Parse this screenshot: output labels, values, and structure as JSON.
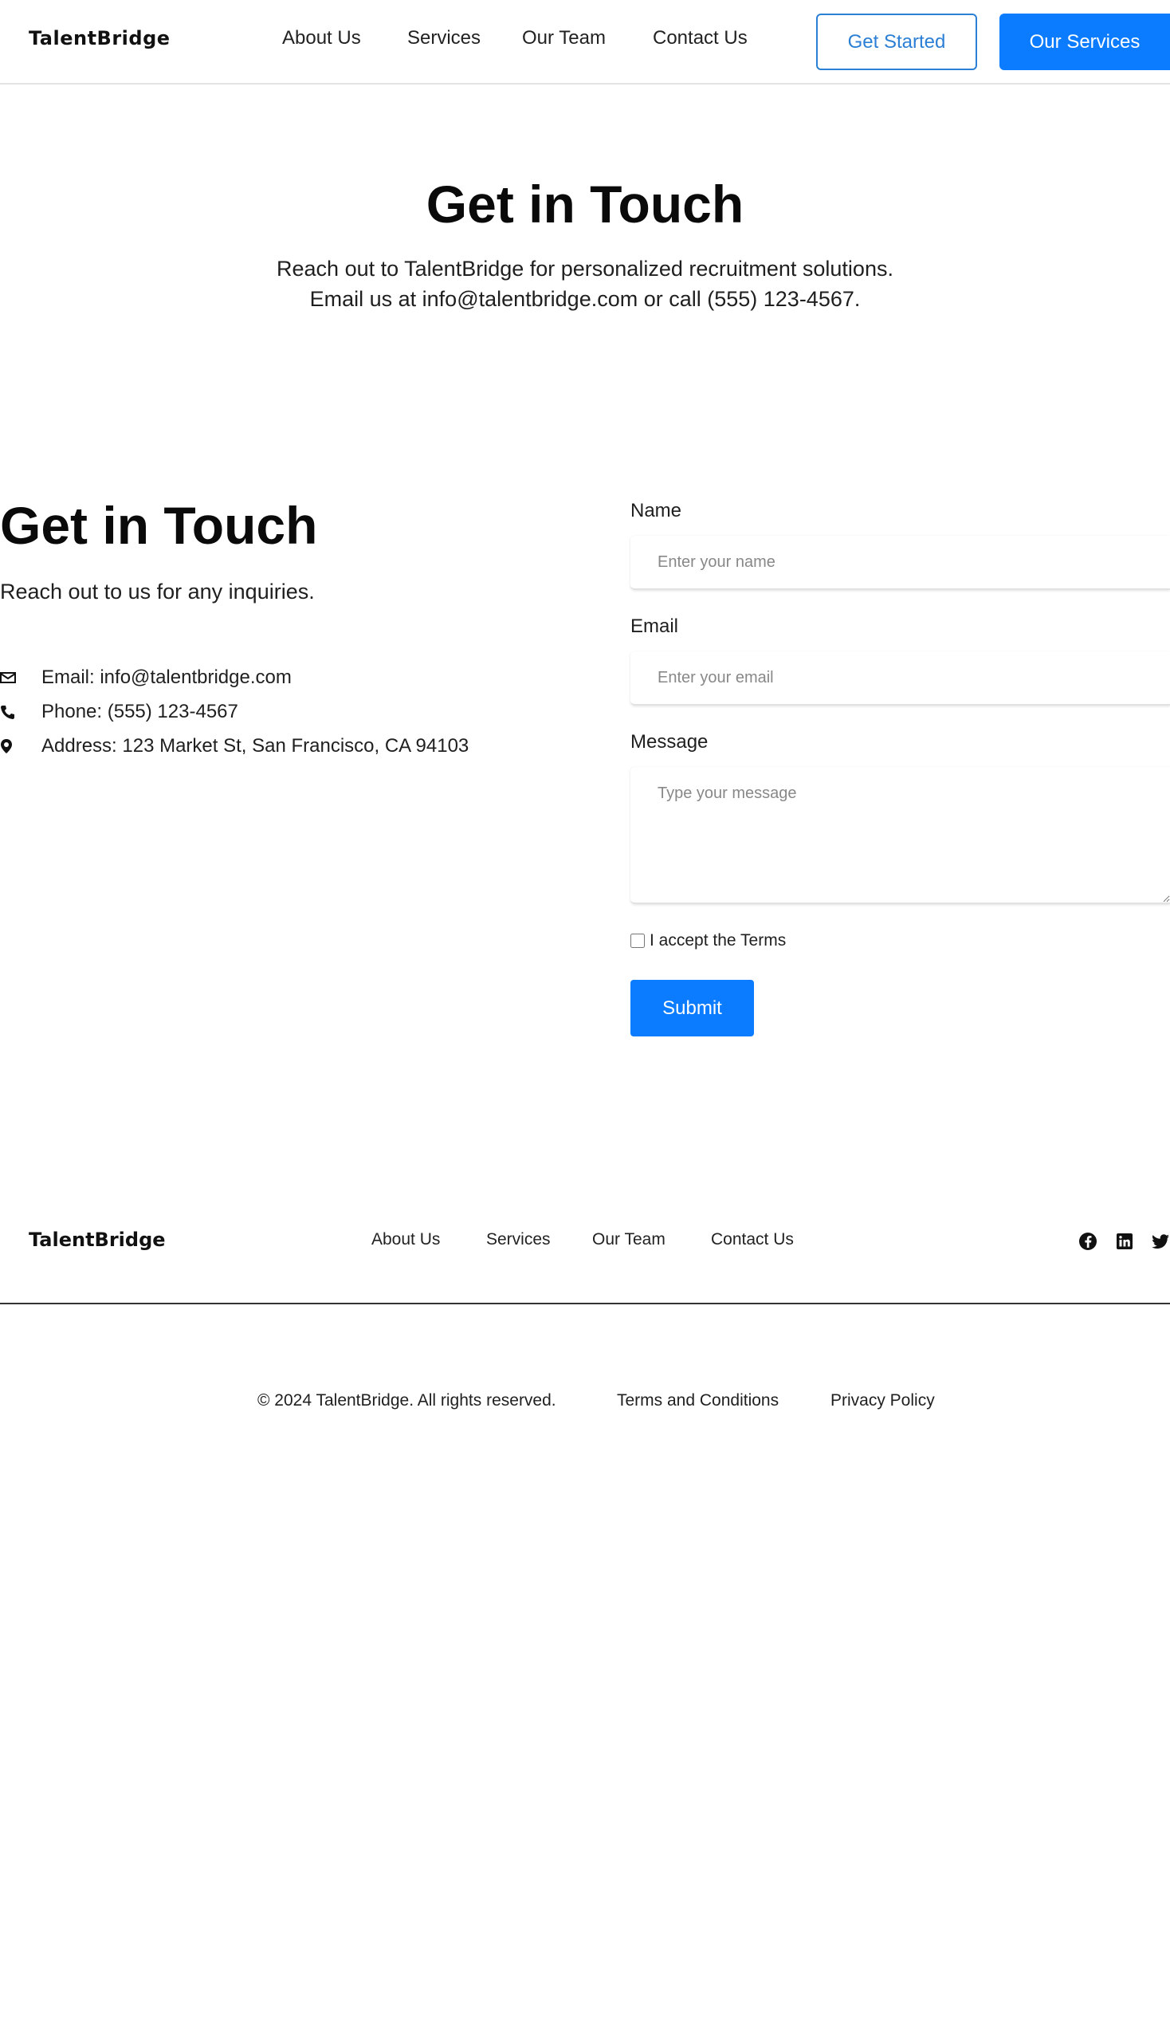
{
  "header": {
    "logo": "TalentBridge",
    "nav": [
      "About Us",
      "Services",
      "Our Team",
      "Contact Us"
    ],
    "get_started": "Get Started",
    "our_services": "Our Services"
  },
  "hero": {
    "title": "Get in Touch",
    "line1": "Reach out to TalentBridge for personalized recruitment solutions.",
    "line2": "Email us at info@talentbridge.com or call (555) 123-4567."
  },
  "contact": {
    "title": "Get in Touch",
    "subtitle": "Reach out to us for any inquiries.",
    "email": "Email: info@talentbridge.com",
    "phone": "Phone: (555) 123-4567",
    "address": "Address: 123 Market St, San Francisco, CA 94103"
  },
  "form": {
    "name_label": "Name",
    "name_placeholder": "Enter your name",
    "email_label": "Email",
    "email_placeholder": "Enter your email",
    "message_label": "Message",
    "message_placeholder": "Type your message",
    "terms_label": "I accept the Terms",
    "submit": "Submit"
  },
  "footer": {
    "logo": "TalentBridge",
    "nav": [
      "About Us",
      "Services",
      "Our Team",
      "Contact Us"
    ],
    "social": [
      "facebook-icon",
      "linkedin-icon",
      "twitter-icon"
    ],
    "copyright": "© 2024 TalentBridge. All rights reserved.",
    "terms": "Terms and Conditions",
    "privacy": "Privacy Policy"
  },
  "colors": {
    "accent": "#0b7bff",
    "outline": "#2b7fd4"
  }
}
